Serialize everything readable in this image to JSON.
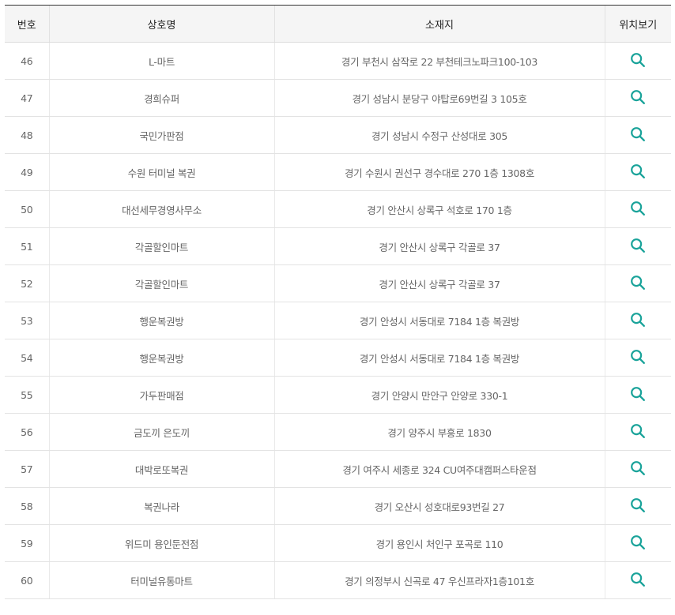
{
  "table": {
    "headers": [
      "번호",
      "상호명",
      "소재지",
      "위치보기"
    ],
    "rows": [
      {
        "no": "46",
        "name": "L-마트",
        "address": "경기 부천시 삼작로 22 부천테크노파크100-103"
      },
      {
        "no": "47",
        "name": "경희슈퍼",
        "address": "경기 성남시 분당구 야탑로69번길 3 105호"
      },
      {
        "no": "48",
        "name": "국민가판점",
        "address": "경기 성남시 수정구 산성대로 305"
      },
      {
        "no": "49",
        "name": "수원 터미널 복권",
        "address": "경기 수원시 권선구 경수대로 270 1층 1308호"
      },
      {
        "no": "50",
        "name": "대선세무경영사무소",
        "address": "경기 안산시 상록구 석호로 170 1층"
      },
      {
        "no": "51",
        "name": "각골할인마트",
        "address": "경기 안산시 상록구 각골로 37"
      },
      {
        "no": "52",
        "name": "각골할인마트",
        "address": "경기 안산시 상록구 각골로 37"
      },
      {
        "no": "53",
        "name": "행운복권방",
        "address": "경기 안성시 서동대로 7184 1층 복권방"
      },
      {
        "no": "54",
        "name": "행운복권방",
        "address": "경기 안성시 서동대로 7184 1층 복권방"
      },
      {
        "no": "55",
        "name": "가두판매점",
        "address": "경기 안양시 만안구 안양로 330-1"
      },
      {
        "no": "56",
        "name": "금도끼 은도끼",
        "address": "경기 양주시 부흥로 1830"
      },
      {
        "no": "57",
        "name": "대박로또복권",
        "address": "경기 여주시 세종로 324 CU여주대캠퍼스타운점"
      },
      {
        "no": "58",
        "name": "복권나라",
        "address": "경기 오산시 성호대로93번길 27"
      },
      {
        "no": "59",
        "name": "위드미 용인둔전점",
        "address": "경기 용인시 처인구 포곡로 110"
      },
      {
        "no": "60",
        "name": "터미널유통마트",
        "address": "경기 의정부시 신곡로 47 우신프라자1층101호"
      }
    ],
    "location_icon": "search-icon",
    "icon_color": "#1aa39a"
  }
}
